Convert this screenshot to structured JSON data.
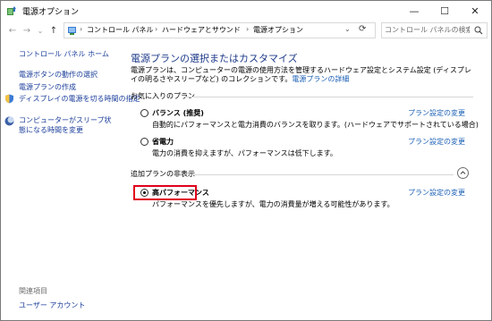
{
  "window": {
    "title": "電源オプション",
    "controls": {
      "minimize": "—",
      "maximize": "☐",
      "close": "✕"
    }
  },
  "navbar": {
    "back": "←",
    "forward": "→",
    "history": "⌄",
    "up": "↑",
    "breadcrumbs": [
      "コントロール パネル",
      "ハードウェアとサウンド",
      "電源オプション"
    ],
    "separator": "›",
    "search_placeholder": "コントロール パネルの検索"
  },
  "sidebar": {
    "home": "コントロール パネル ホーム",
    "items": [
      "電源ボタンの動作の選択",
      "電源プランの作成",
      "ディスプレイの電源を切る時間の指定",
      "コンピューターがスリープ状態になる時間を変更"
    ],
    "related_heading": "関連項目",
    "related_items": [
      "ユーザー アカウント"
    ]
  },
  "main": {
    "title": "電源プランの選択またはカスタマイズ",
    "description": "電源プランは、コンピューターの電源の使用方法を管理するハードウェア設定とシステム設定 (ディスプレイの明るさやスリープなど) のコレクションです。",
    "description_link": "電源プランの詳細",
    "favorites_label": "お気に入りのプラン",
    "hidden_label": "追加プランの非表示",
    "change_label": "プラン設定の変更",
    "plans": [
      {
        "name": "バランス (推奨)",
        "desc": "自動的にパフォーマンスと電力消費のバランスを取ります。(ハードウェアでサポートされている場合)",
        "selected": false
      },
      {
        "name": "省電力",
        "desc": "電力の消費を抑えますが、パフォーマンスは低下します。",
        "selected": false
      },
      {
        "name": "高パフォーマンス",
        "desc": "パフォーマンスを優先しますが、電力の消費量が増える可能性があります。",
        "selected": true
      }
    ]
  },
  "colors": {
    "link": "#1a5fb4",
    "title": "#1e3a8a",
    "highlight": "#e0001b"
  }
}
